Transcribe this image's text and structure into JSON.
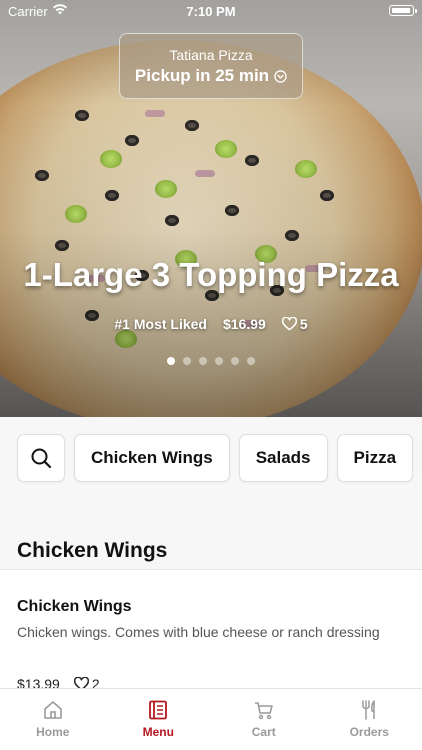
{
  "status_bar": {
    "carrier": "Carrier",
    "time": "7:10 PM"
  },
  "store": {
    "name": "Tatiana Pizza",
    "pickup": "Pickup in 25 min"
  },
  "featured": {
    "title": "1-Large 3 Topping Pizza",
    "tag": "#1 Most Liked",
    "price": "$16.99",
    "likes": "5",
    "slides_total": 6,
    "slide_active": 1
  },
  "categories": [
    "Chicken Wings",
    "Salads",
    "Pizza"
  ],
  "section": {
    "title": "Chicken Wings"
  },
  "item": {
    "title": "Chicken Wings",
    "description": "Chicken wings. Comes with blue cheese or ranch dressing",
    "price": "$13.99",
    "likes": "2"
  },
  "tabs": [
    {
      "label": "Home",
      "icon": "home-icon"
    },
    {
      "label": "Menu",
      "icon": "menu-icon"
    },
    {
      "label": "Cart",
      "icon": "cart-icon"
    },
    {
      "label": "Orders",
      "icon": "utensils-icon"
    }
  ],
  "colors": {
    "accent": "#b3181f",
    "inactive_tab": "#9a9a9a"
  }
}
